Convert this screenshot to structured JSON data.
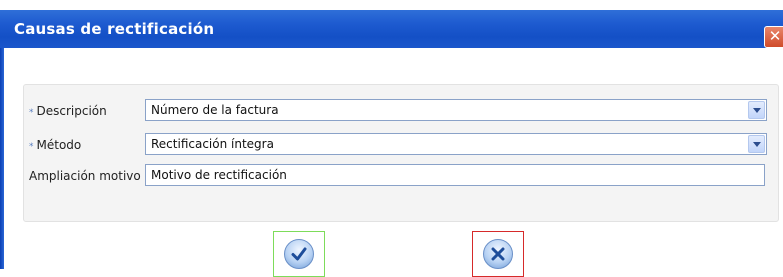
{
  "window": {
    "title": "Causas de rectificación",
    "close_label": "✕"
  },
  "form": {
    "descripcion": {
      "label": "Descripción",
      "required_marker": "*",
      "value": "Número de la factura"
    },
    "metodo": {
      "label": "Método",
      "required_marker": "*",
      "value": "Rectificación íntegra"
    },
    "ampliacion": {
      "label": "Ampliación motivo",
      "value": "Motivo de rectificación"
    }
  },
  "buttons": {
    "accept": {
      "icon": "check-icon",
      "border_color": "#7ddc5a"
    },
    "cancel": {
      "icon": "x-icon",
      "border_color": "#d62a2a"
    }
  },
  "colors": {
    "titlebar": "#1450c6",
    "field_border": "#8aa2c8",
    "panel": "#f4f4f4"
  }
}
